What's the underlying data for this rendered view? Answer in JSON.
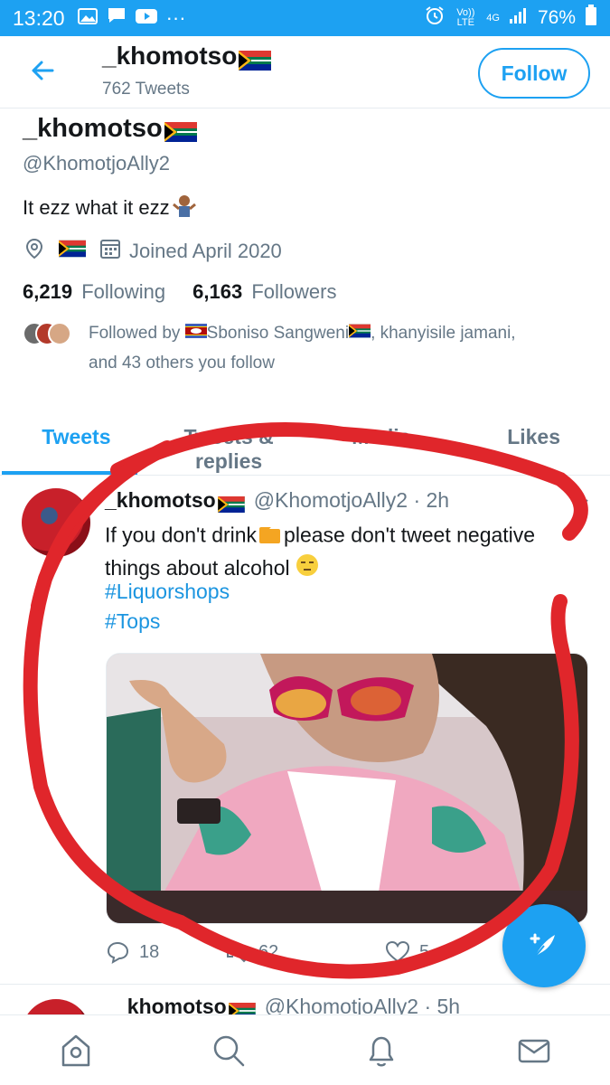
{
  "status_bar": {
    "time": "13:20",
    "dots": "···",
    "volte": "Vo)) LTE",
    "network": "4G",
    "battery": "76%"
  },
  "header": {
    "name": "_khomotso",
    "tweet_count": "762 Tweets",
    "follow_label": "Follow"
  },
  "profile": {
    "name": "_khomotso",
    "handle": "@KhomotjoAlly2",
    "bio": "It ezz what it ezz",
    "joined": "Joined April 2020",
    "following_count": "6,219",
    "following_label": "Following",
    "followers_count": "6,163",
    "followers_label": "Followers",
    "followed_by_prefix": "Followed by",
    "followed_by_names": "Sboniso Sangweni",
    "followed_by_rest": ", khanyisile jamani,",
    "followed_by_more": "and 43 others you follow"
  },
  "tabs": [
    {
      "label": "Tweets"
    },
    {
      "label": "Tweets & replies"
    },
    {
      "label": "Media"
    },
    {
      "label": "Likes"
    }
  ],
  "tweet": {
    "name": "_khomotso",
    "handle": "@KhomotjoAlly2 · 2h",
    "text_part1": "If you don't drink",
    "text_part2": "please don't tweet negative things about alcohol",
    "hashtag1": "#Liquorshops",
    "hashtag2": "#Tops",
    "replies": "18",
    "retweets": "62",
    "likes": "5"
  },
  "tweet2": {
    "name": "_khomotso",
    "handle": "@KhomotjoAlly2 · 5h"
  },
  "colors": {
    "brand": "#1da1f2",
    "annotation": "#e0262b"
  }
}
